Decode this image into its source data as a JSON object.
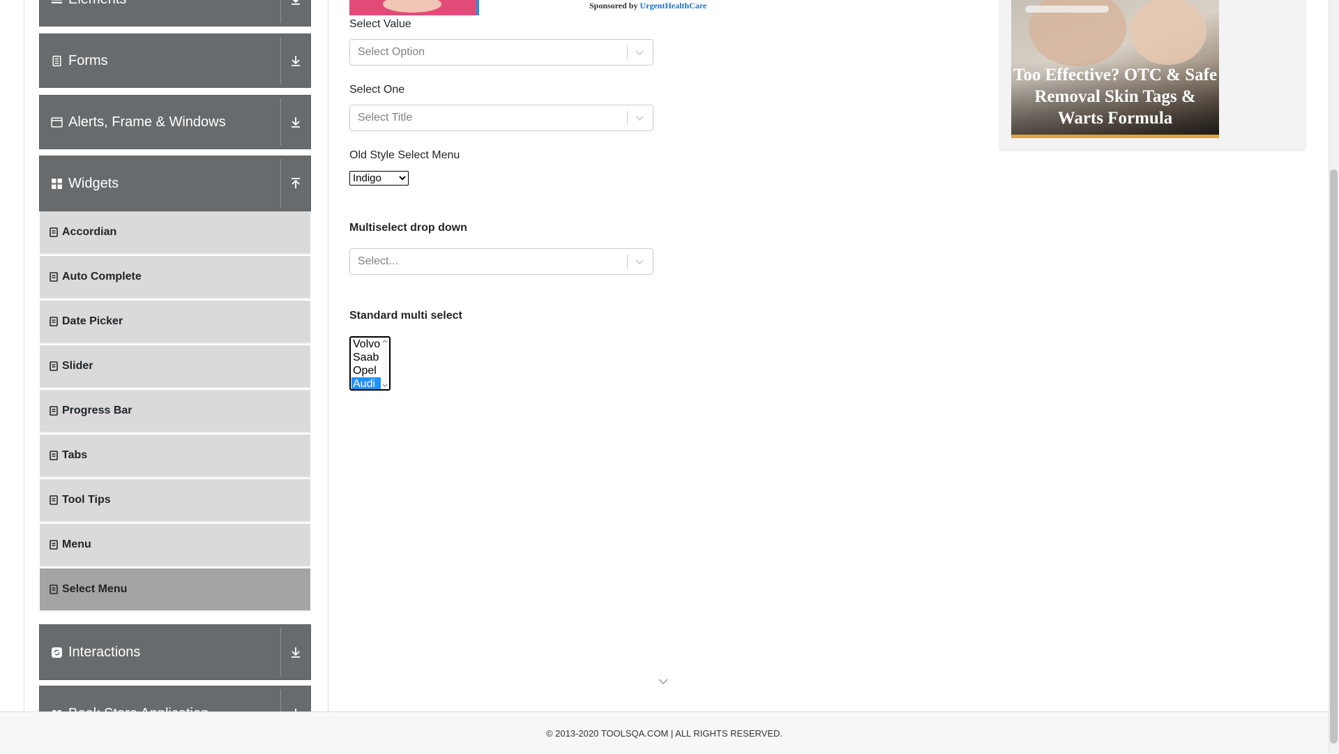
{
  "sidebar": {
    "groups": {
      "elements": {
        "label": "Elements",
        "icon": "hamburger-icon",
        "arrow": "download-icon"
      },
      "forms": {
        "label": "Forms",
        "icon": "document-icon",
        "arrow": "download-icon"
      },
      "alerts": {
        "label": "Alerts, Frame & Windows",
        "icon": "window-icon",
        "arrow": "download-icon"
      },
      "widgets": {
        "label": "Widgets",
        "icon": "grid-icon",
        "arrow": "upload-icon"
      },
      "interactions": {
        "label": "Interactions",
        "icon": "refresh-icon",
        "arrow": "download-icon"
      },
      "bookstore": {
        "label": "Book Store Application",
        "icon": "book-icon",
        "arrow": "download-icon"
      }
    },
    "widget_items": [
      {
        "label": "Accordian"
      },
      {
        "label": "Auto Complete"
      },
      {
        "label": "Date Picker"
      },
      {
        "label": "Slider"
      },
      {
        "label": "Progress Bar"
      },
      {
        "label": "Tabs"
      },
      {
        "label": "Tool Tips"
      },
      {
        "label": "Menu"
      },
      {
        "label": "Select Menu"
      }
    ],
    "active_item": "Select Menu"
  },
  "ad_top": {
    "sponsored_prefix": "Sponsored by ",
    "brand": "UrgentHealthCare"
  },
  "form": {
    "select_value": {
      "label": "Select Value",
      "placeholder": "Select Option"
    },
    "select_one": {
      "label": "Select One",
      "placeholder": "Select Title"
    },
    "old_style": {
      "label": "Old Style Select Menu",
      "selected": "Indigo"
    },
    "multiselect": {
      "label": "Multiselect drop down",
      "placeholder": "Select..."
    },
    "standard_multi": {
      "label": "Standard multi select",
      "options": [
        "Volvo",
        "Saab",
        "Opel",
        "Audi"
      ],
      "selected": "Audi"
    }
  },
  "ad_right": {
    "headline": "Too Effective? OTC & Safe Removal Skin Tags & Warts Formula",
    "accent_color": "#e0a43a"
  },
  "footer": {
    "text": "© 2013-2020 TOOLSQA.COM | ALL RIGHTS RESERVED."
  },
  "colors": {
    "group_bg": "#676b6e",
    "item_bg": "#dadada",
    "active_item_bg": "#a4a4a4",
    "link": "#1a73c8"
  }
}
